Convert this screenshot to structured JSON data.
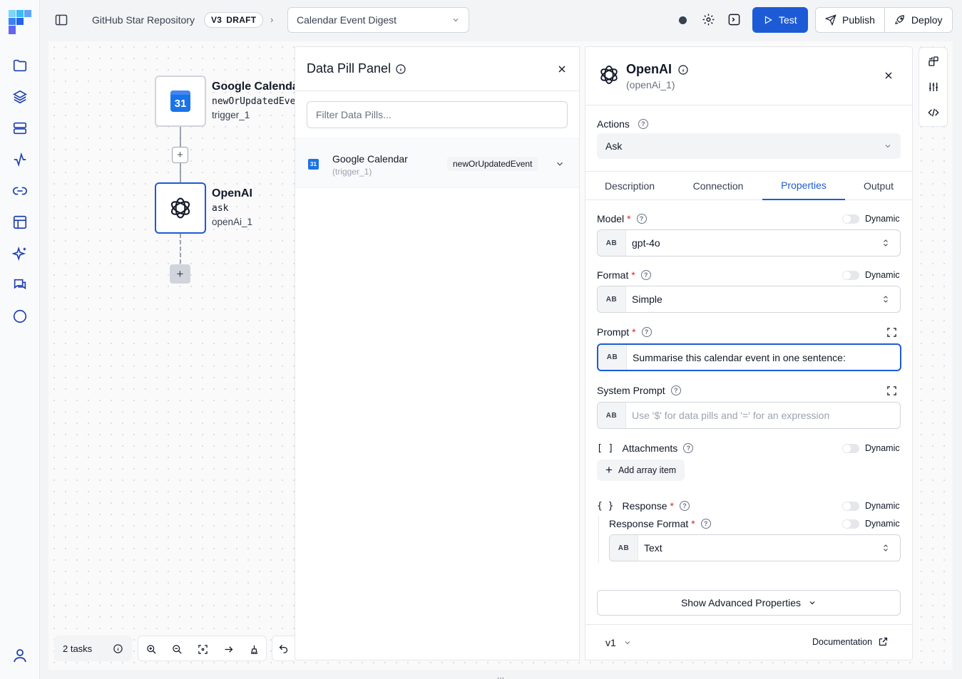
{
  "header": {
    "project": "GitHub Star Repository",
    "version": "V3",
    "status": "DRAFT",
    "workflow": "Calendar Event Digest",
    "test_label": "Test",
    "publish_label": "Publish",
    "deploy_label": "Deploy"
  },
  "canvas": {
    "nodes": [
      {
        "title": "Google Calendar",
        "operation": "newOrUpdatedEvent",
        "id": "trigger_1",
        "icon": "google-calendar-icon",
        "icon_text": "31"
      },
      {
        "title": "OpenAI",
        "operation": "ask",
        "id": "openAi_1",
        "icon": "openai-icon"
      }
    ],
    "tasks_label": "2 tasks"
  },
  "pill_panel": {
    "title": "Data Pill Panel",
    "filter_placeholder": "Filter Data Pills...",
    "item": {
      "title": "Google Calendar",
      "id": "(trigger_1)",
      "badge": "newOrUpdatedEvent",
      "icon_text": "31"
    }
  },
  "props": {
    "title": "OpenAI",
    "subtitle": "(openAi_1)",
    "actions_label": "Actions",
    "action_value": "Ask",
    "tabs": [
      "Description",
      "Connection",
      "Properties",
      "Output"
    ],
    "active_tab": "Properties",
    "dynamic_label": "Dynamic",
    "type_badge": "AB",
    "model_label": "Model",
    "model_value": "gpt-4o",
    "format_label": "Format",
    "format_value": "Simple",
    "prompt_label": "Prompt",
    "prompt_value": "Summarise this calendar event in one sentence:",
    "system_prompt_label": "System Prompt",
    "system_prompt_placeholder": "Use '$' for data pills and '=' for an expression",
    "attachments_label": "Attachments",
    "add_array_label": "Add array item",
    "response_label": "Response",
    "response_format_label": "Response Format",
    "response_format_value": "Text",
    "advanced_label": "Show Advanced Properties",
    "version": "v1",
    "documentation_label": "Documentation"
  },
  "colors": {
    "accent": "#1d5bd6",
    "required": "#dc2626"
  }
}
